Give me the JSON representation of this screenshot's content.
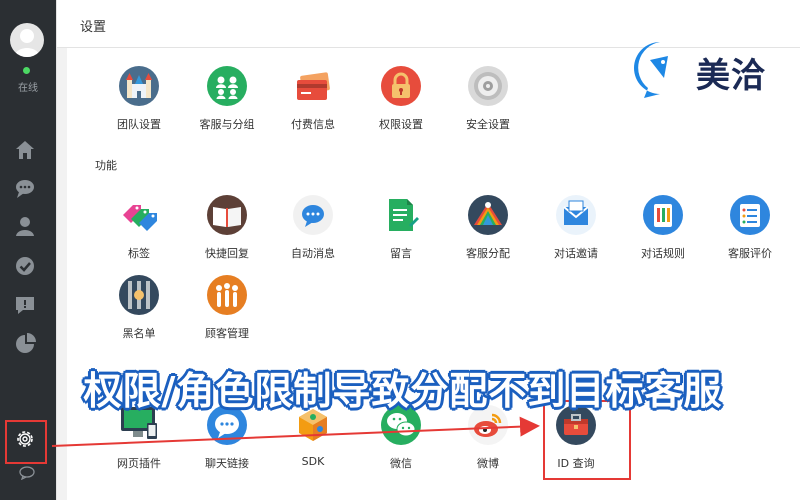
{
  "sidebar": {
    "status": "在线",
    "nav": [
      {
        "name": "home-icon"
      },
      {
        "name": "chat-bubble-icon"
      },
      {
        "name": "user-icon"
      },
      {
        "name": "check-circle-icon"
      },
      {
        "name": "message-alert-icon"
      },
      {
        "name": "pie-chart-icon"
      }
    ],
    "settings_icon": "gear-icon",
    "bottom_icon": "chat-outline-icon"
  },
  "header": {
    "title": "设置"
  },
  "brand": {
    "name": "美洽",
    "logo_icon": "meiqia-logo-icon",
    "color": "#1b2a55"
  },
  "sections": {
    "basic": {
      "items": [
        {
          "label": "团队设置",
          "icon": "castle-icon",
          "color": "#4a6d8c"
        },
        {
          "label": "客服与分组",
          "icon": "people-group-icon",
          "color": "#27ae60"
        },
        {
          "label": "付费信息",
          "icon": "credit-card-icon",
          "color": "#e74c3c"
        },
        {
          "label": "权限设置",
          "icon": "lock-icon",
          "color": "#e74c3c"
        },
        {
          "label": "安全设置",
          "icon": "safe-icon",
          "color": "#bdbdbd"
        }
      ]
    },
    "features": {
      "title": "功能",
      "items": [
        {
          "label": "标签",
          "icon": "tags-icon",
          "color": "#e84393"
        },
        {
          "label": "快捷回复",
          "icon": "book-icon",
          "color": "#5d4037"
        },
        {
          "label": "自动消息",
          "icon": "auto-message-icon",
          "color": "#2e86de"
        },
        {
          "label": "留言",
          "icon": "note-icon",
          "color": "#27ae60"
        },
        {
          "label": "客服分配",
          "icon": "distribution-icon",
          "color": "#34495e"
        },
        {
          "label": "对话邀请",
          "icon": "invite-mail-icon",
          "color": "#2e86de"
        },
        {
          "label": "对话规则",
          "icon": "rules-icon",
          "color": "#2e86de"
        },
        {
          "label": "客服评价",
          "icon": "rating-icon",
          "color": "#2e86de"
        },
        {
          "label": "黑名单",
          "icon": "blacklist-icon",
          "color": "#34495e"
        },
        {
          "label": "顾客管理",
          "icon": "customer-management-icon",
          "color": "#e67e22"
        }
      ]
    },
    "channels": {
      "items": [
        {
          "label": "网页插件",
          "icon": "web-plugin-icon",
          "color": "#2c3e50"
        },
        {
          "label": "聊天链接",
          "icon": "chat-link-icon",
          "color": "#2e86de"
        },
        {
          "label": "SDK",
          "icon": "sdk-icon",
          "color": "#f39c12"
        },
        {
          "label": "微信",
          "icon": "wechat-icon",
          "color": "#27ae60"
        },
        {
          "label": "微博",
          "icon": "weibo-icon",
          "color": "#f39c12"
        },
        {
          "label": "ID 查询",
          "icon": "id-query-icon",
          "color": "#34495e"
        }
      ]
    }
  },
  "annotation": {
    "banner": "权限/角色限制导致分配不到目标客服",
    "highlight_color": "#e53935",
    "banner_stroke_color": "#1b5fbf"
  }
}
